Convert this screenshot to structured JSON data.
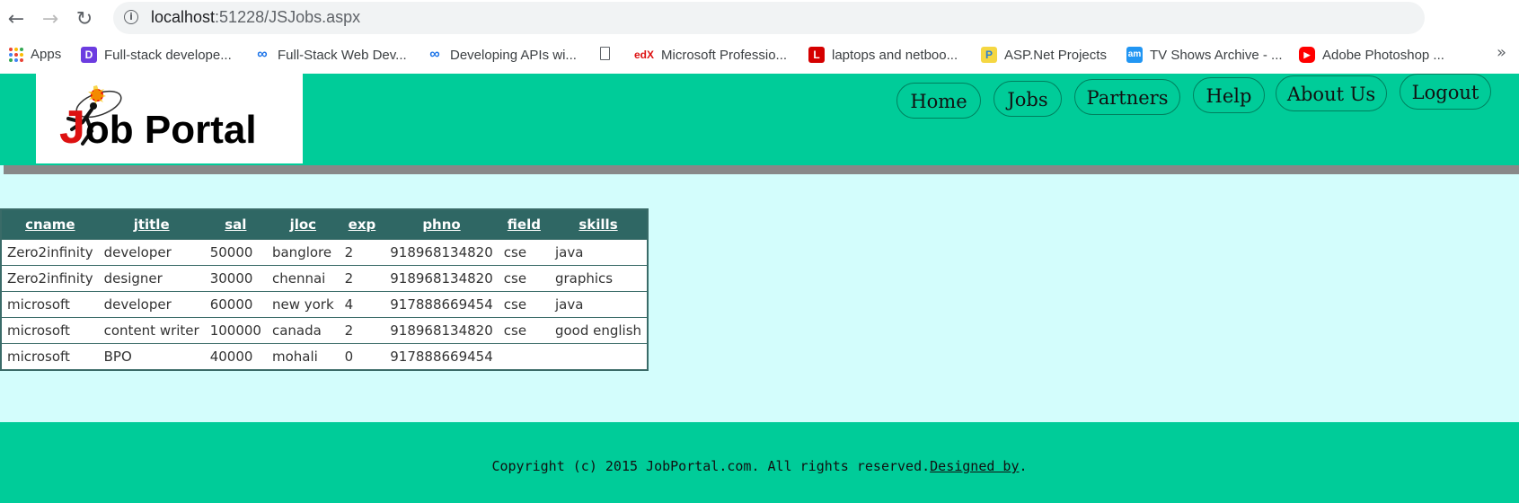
{
  "browser": {
    "url_host": "localhost",
    "url_rest": ":51228/JSJobs.aspx",
    "bookmarks": [
      {
        "label": "Apps",
        "icon": "apps-grid-icon"
      },
      {
        "label": "Full-stack develope...",
        "icon": "purple-d-icon",
        "color": "#6c3ce0"
      },
      {
        "label": "Full-Stack Web Dev...",
        "icon": "infinity-icon",
        "color": "#1a73e8"
      },
      {
        "label": "Developing APIs wi...",
        "icon": "infinity-icon",
        "color": "#1a73e8"
      },
      {
        "label": "",
        "icon": "document-icon"
      },
      {
        "label": "Microsoft Professio...",
        "icon": "edx-icon",
        "color": "#02262b"
      },
      {
        "label": "laptops and netboo...",
        "icon": "red-l-icon",
        "color": "#d50000"
      },
      {
        "label": "ASP.Net Projects",
        "icon": "p-icon",
        "color": "#2a7fd4"
      },
      {
        "label": "TV Shows Archive - ...",
        "icon": "am-icon",
        "color": "#2196f3"
      },
      {
        "label": "Adobe Photoshop ...",
        "icon": "youtube-icon",
        "color": "#ff0000"
      }
    ],
    "more": "»"
  },
  "header": {
    "logo_rest": "ob Portal",
    "logo_j": "J",
    "menu": [
      "Home",
      "Jobs",
      "Partners",
      "Help",
      "About Us",
      "Logout"
    ],
    "bg_color": "#00cc99"
  },
  "table": {
    "columns": [
      "cname",
      "jtitle",
      "sal",
      "jloc",
      "exp",
      "phno",
      "field",
      "skills"
    ],
    "rows": [
      [
        "Zero2infinity",
        "developer",
        "50000",
        "banglore",
        "2",
        "918968134820",
        "cse",
        "java"
      ],
      [
        "Zero2infinity",
        "designer",
        "30000",
        "chennai",
        "2",
        "918968134820",
        "cse",
        "graphics"
      ],
      [
        "microsoft",
        "developer",
        "60000",
        "new york",
        "4",
        "917888669454",
        "cse",
        "java"
      ],
      [
        "microsoft",
        "content writer",
        "100000",
        "canada",
        "2",
        "918968134820",
        "cse",
        "good english"
      ],
      [
        "microsoft",
        "BPO",
        "40000",
        "mohali",
        "0",
        "917888669454",
        "",
        ""
      ]
    ]
  },
  "footer": {
    "text": "Copyright (c) 2015 JobPortal.com. All rights reserved.",
    "link": "Designed by",
    "suffix": "."
  }
}
